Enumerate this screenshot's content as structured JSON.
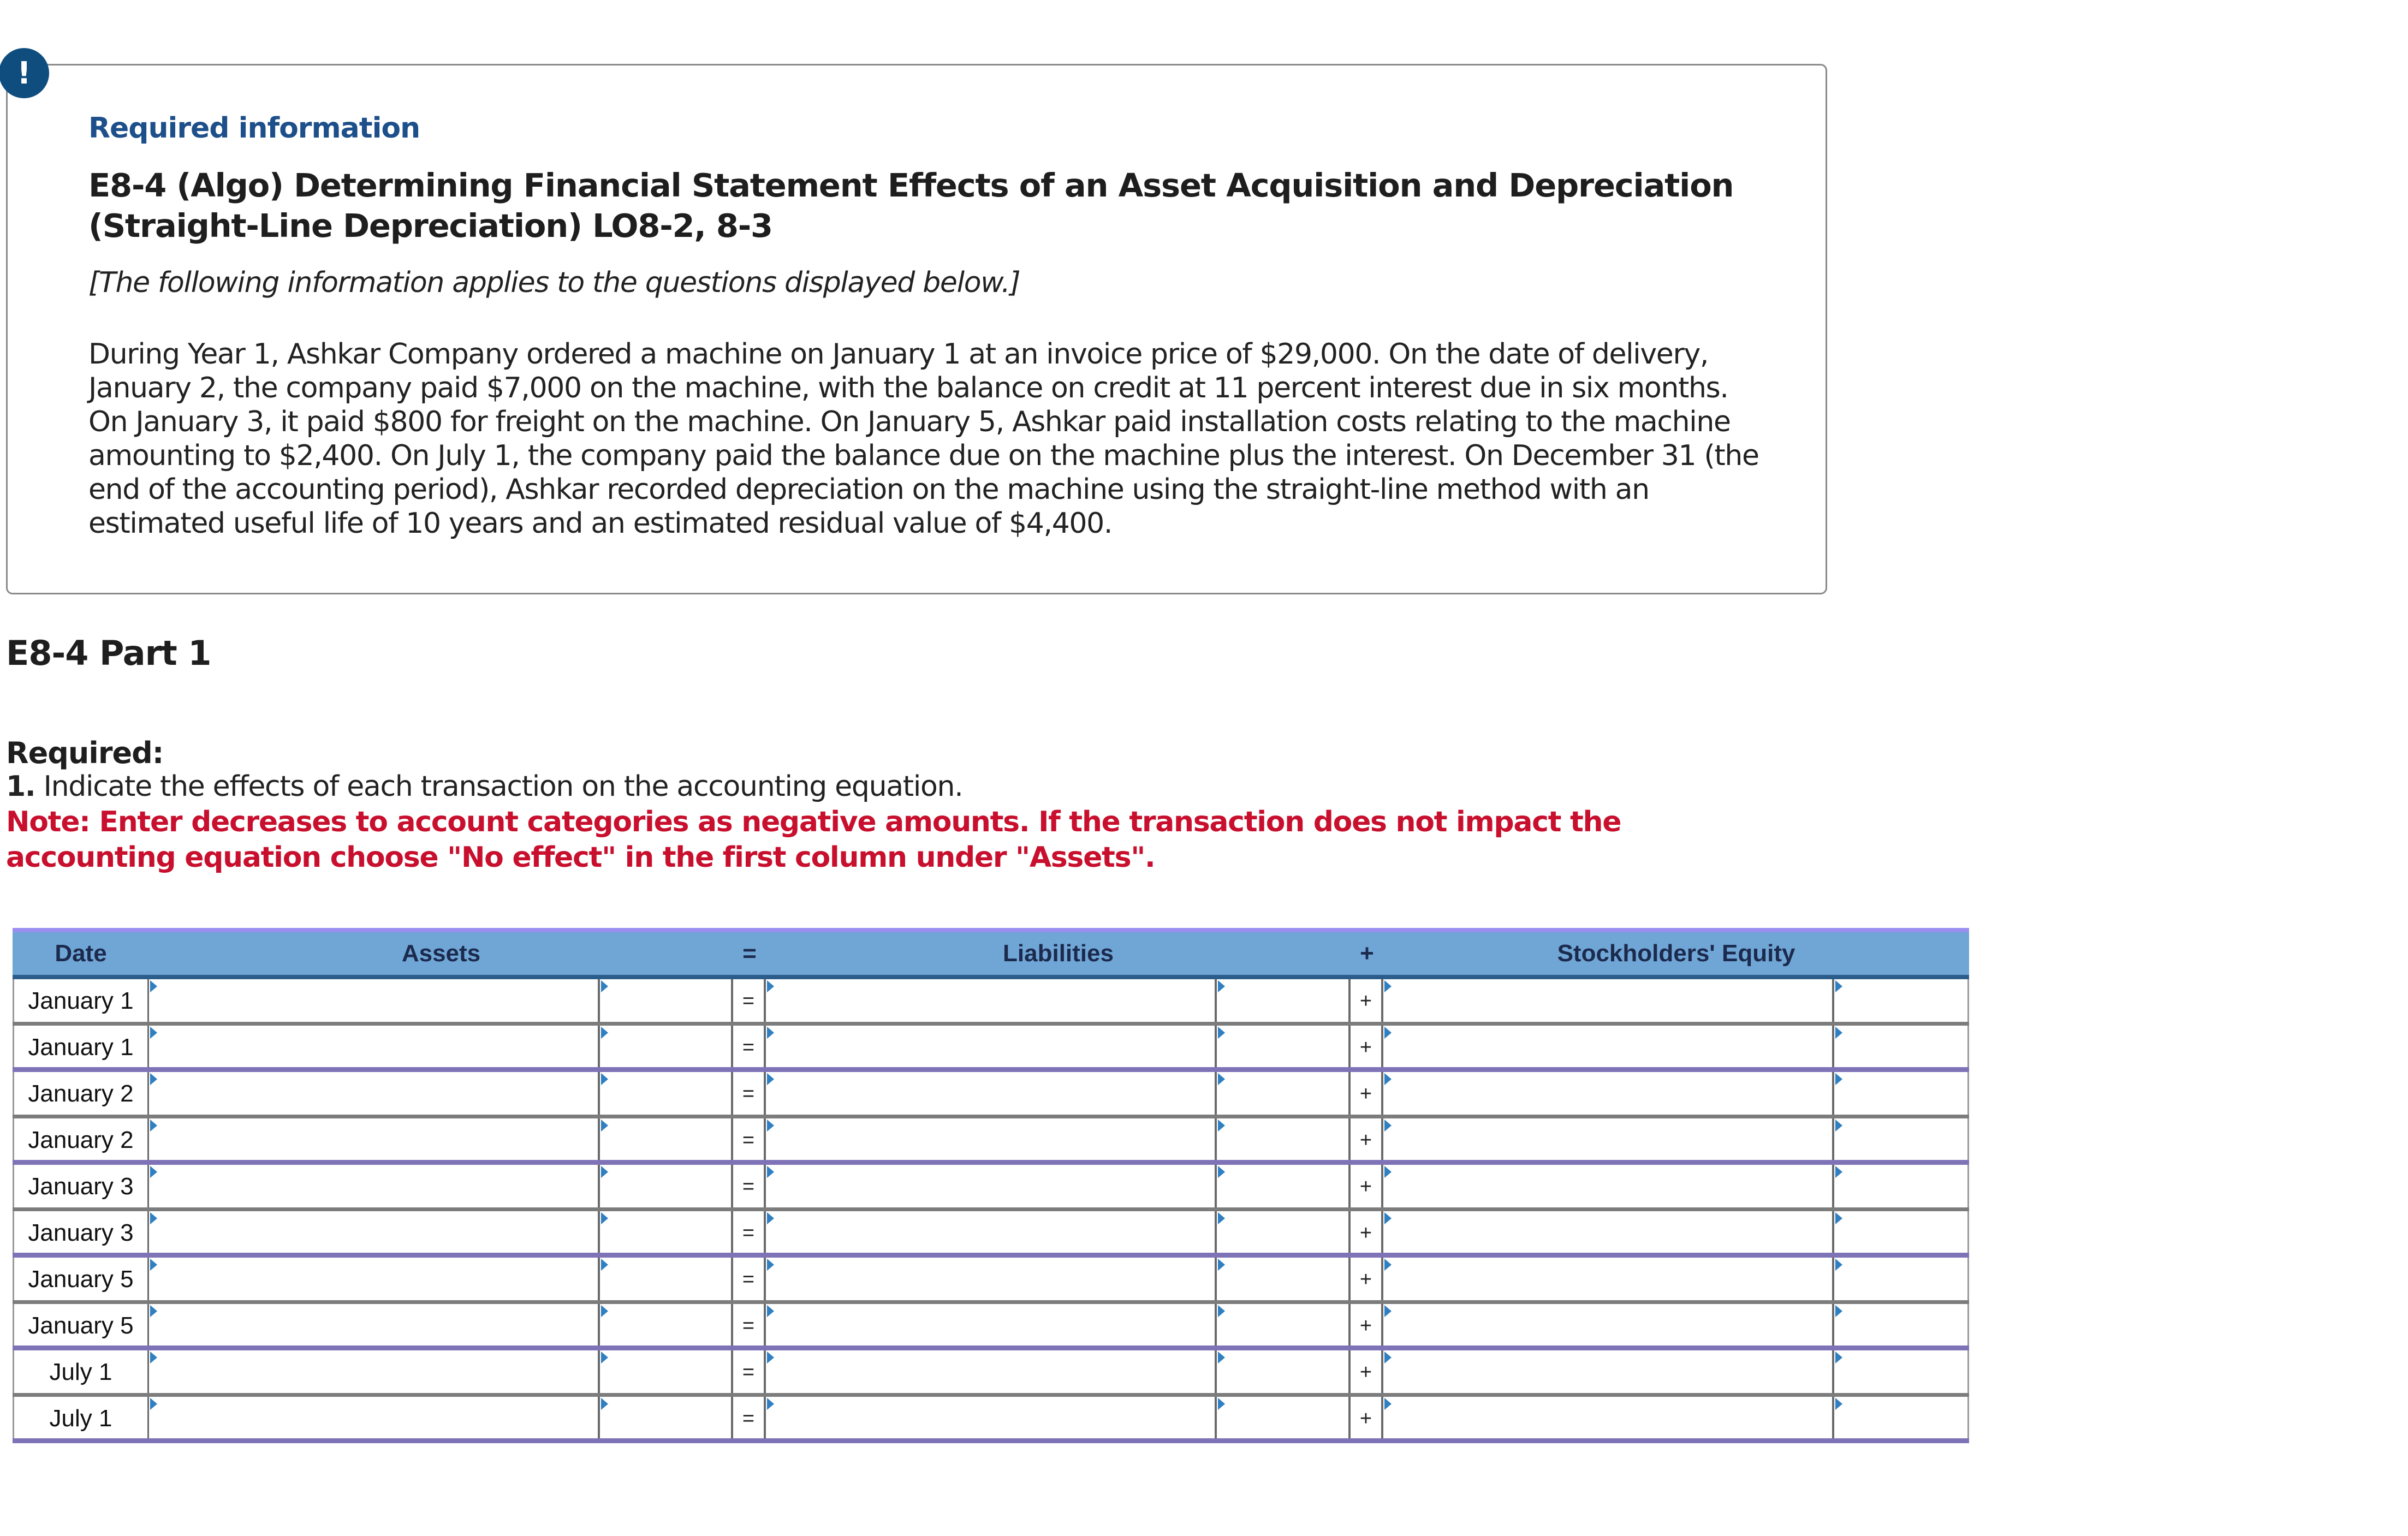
{
  "alert": {
    "icon": "exclamation-icon",
    "glyph": "!"
  },
  "info": {
    "heading": "Required information",
    "title": "E8-4 (Algo) Determining Financial Statement Effects of an Asset Acquisition and Depreciation (Straight-Line Depreciation) LO8-2, 8-3",
    "applies_note": "[The following information applies to the questions displayed below.]",
    "paragraph": "During Year 1, Ashkar Company ordered a machine on January 1 at an invoice price of $29,000. On the date of delivery, January 2, the company paid $7,000 on the machine, with the balance on credit at 11 percent interest due in six months. On January 3, it paid $800 for freight on the machine. On January 5, Ashkar paid installation costs relating to the machine amounting to $2,400. On July 1, the company paid the balance due on the machine plus the interest. On December 31 (the end of the accounting period), Ashkar recorded depreciation on the machine using the straight-line method with an estimated useful life of 10 years and an estimated residual value of $4,400."
  },
  "part": {
    "title": "E8-4 Part 1",
    "required_label": "Required:",
    "instruction_number": "1.",
    "instruction_text": "Indicate the effects of each transaction on the accounting equation.",
    "note": "Note: Enter decreases to account categories as negative amounts. If the transaction does not impact the accounting equation choose \"No effect\" in the first column under \"Assets\"."
  },
  "table": {
    "headers": {
      "date": "Date",
      "assets": "Assets",
      "equals": "=",
      "liabilities": "Liabilities",
      "plus": "+",
      "equity": "Stockholders' Equity"
    },
    "row_equals": "=",
    "row_plus": "+",
    "rows": [
      {
        "date": "January 1",
        "assets_account": "",
        "assets_amount": "",
        "liabilities_account": "",
        "liabilities_amount": "",
        "equity_account": "",
        "equity_amount": ""
      },
      {
        "date": "January 1",
        "assets_account": "",
        "assets_amount": "",
        "liabilities_account": "",
        "liabilities_amount": "",
        "equity_account": "",
        "equity_amount": ""
      },
      {
        "date": "January 2",
        "assets_account": "",
        "assets_amount": "",
        "liabilities_account": "",
        "liabilities_amount": "",
        "equity_account": "",
        "equity_amount": ""
      },
      {
        "date": "January 2",
        "assets_account": "",
        "assets_amount": "",
        "liabilities_account": "",
        "liabilities_amount": "",
        "equity_account": "",
        "equity_amount": ""
      },
      {
        "date": "January 3",
        "assets_account": "",
        "assets_amount": "",
        "liabilities_account": "",
        "liabilities_amount": "",
        "equity_account": "",
        "equity_amount": ""
      },
      {
        "date": "January 3",
        "assets_account": "",
        "assets_amount": "",
        "liabilities_account": "",
        "liabilities_amount": "",
        "equity_account": "",
        "equity_amount": ""
      },
      {
        "date": "January 5",
        "assets_account": "",
        "assets_amount": "",
        "liabilities_account": "",
        "liabilities_amount": "",
        "equity_account": "",
        "equity_amount": ""
      },
      {
        "date": "January 5",
        "assets_account": "",
        "assets_amount": "",
        "liabilities_account": "",
        "liabilities_amount": "",
        "equity_account": "",
        "equity_amount": ""
      },
      {
        "date": "July 1",
        "assets_account": "",
        "assets_amount": "",
        "liabilities_account": "",
        "liabilities_amount": "",
        "equity_account": "",
        "equity_amount": ""
      },
      {
        "date": "July 1",
        "assets_account": "",
        "assets_amount": "",
        "liabilities_account": "",
        "liabilities_amount": "",
        "equity_account": "",
        "equity_amount": ""
      }
    ]
  },
  "colors": {
    "header_bg": "#6fa6d6",
    "alert": "#104d7f",
    "note_red": "#c8102e",
    "heading_blue": "#1d4f8a",
    "row_pair_border": "#7f73b8"
  }
}
